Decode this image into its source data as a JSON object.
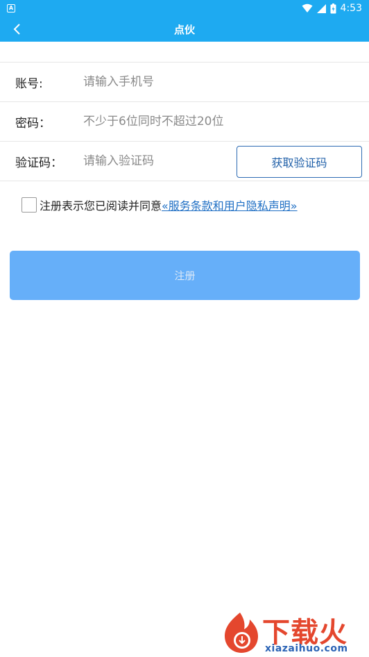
{
  "status_bar": {
    "notification_icon": "A",
    "time": "4:53",
    "icons": [
      "wifi-icon",
      "cell-signal-icon",
      "battery-icon"
    ],
    "color": "#1eaaf1"
  },
  "app_bar": {
    "title": "点伙",
    "back_icon": "chevron-left-icon",
    "color": "#1eaaf1"
  },
  "form": {
    "account": {
      "label": "账号:",
      "placeholder": "请输入手机号",
      "value": ""
    },
    "password": {
      "label": "密码：",
      "placeholder": "不少于6位同时不超过20位",
      "value": ""
    },
    "code": {
      "label": "验证码：",
      "placeholder": "请输入验证码",
      "value": "",
      "button_label": "获取验证码"
    }
  },
  "agreement": {
    "checked": false,
    "text": "注册表示您已阅读并同意",
    "link_text": "«服务条款和用户隐私声明»"
  },
  "register_button": {
    "label": "注册",
    "color": "#66aff9"
  },
  "watermark": {
    "title": "下载火",
    "url": "xiazaihuo.com",
    "colors": {
      "brand": "#e4472e",
      "url": "#2b63b5"
    }
  }
}
